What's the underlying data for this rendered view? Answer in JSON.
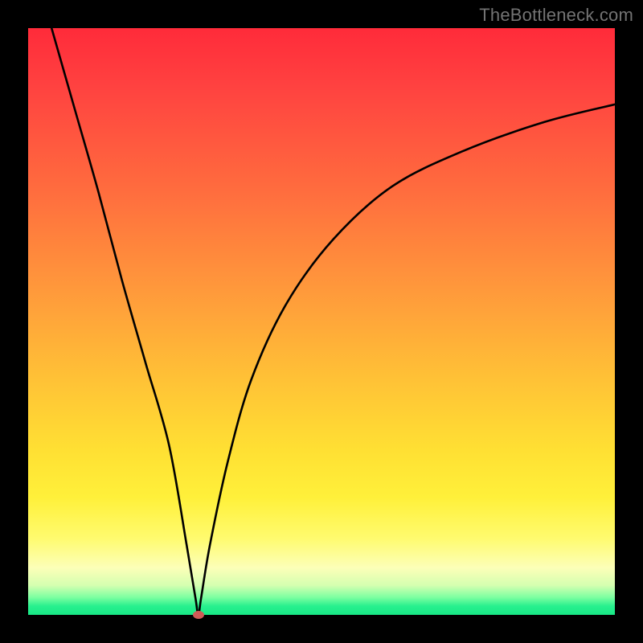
{
  "watermark": "TheBottleneck.com",
  "colors": {
    "frame": "#000000",
    "curve": "#000000",
    "marker": "#cf5a57",
    "gradient_stops": [
      {
        "pos": 0.0,
        "hex": "#ff2b3a"
      },
      {
        "pos": 0.1,
        "hex": "#ff4240"
      },
      {
        "pos": 0.28,
        "hex": "#ff6d3e"
      },
      {
        "pos": 0.45,
        "hex": "#ff9a3b"
      },
      {
        "pos": 0.6,
        "hex": "#ffc236"
      },
      {
        "pos": 0.72,
        "hex": "#ffe033"
      },
      {
        "pos": 0.8,
        "hex": "#fff03a"
      },
      {
        "pos": 0.87,
        "hex": "#fffb6f"
      },
      {
        "pos": 0.92,
        "hex": "#fcffb8"
      },
      {
        "pos": 0.95,
        "hex": "#d4ffb0"
      },
      {
        "pos": 0.97,
        "hex": "#7dffa1"
      },
      {
        "pos": 0.985,
        "hex": "#28f08e"
      },
      {
        "pos": 1.0,
        "hex": "#18e886"
      }
    ]
  },
  "chart_data": {
    "type": "line",
    "title": "",
    "xlabel": "",
    "ylabel": "",
    "xlim": [
      0,
      100
    ],
    "ylim": [
      0,
      100
    ],
    "notes": "V-shaped bottleneck curve. Left branch descends steeply and near-linearly from top-left to the minimum. Right branch rises with diminishing slope (concave) toward the right edge. Minimum (optimal point) at roughly x≈29 where y≈0. Marker indicates the optimal/no-bottleneck point.",
    "series": [
      {
        "name": "bottleneck-curve",
        "x": [
          4,
          8,
          12,
          16,
          20,
          24,
          27,
          28.5,
          29,
          29.5,
          31,
          34,
          38,
          44,
          52,
          62,
          74,
          88,
          100
        ],
        "y": [
          100,
          86,
          72,
          57,
          43,
          29,
          12,
          3,
          0,
          3,
          12,
          26,
          40,
          53,
          64,
          73,
          79,
          84,
          87
        ]
      }
    ],
    "marker": {
      "x": 29,
      "y": 0
    }
  }
}
